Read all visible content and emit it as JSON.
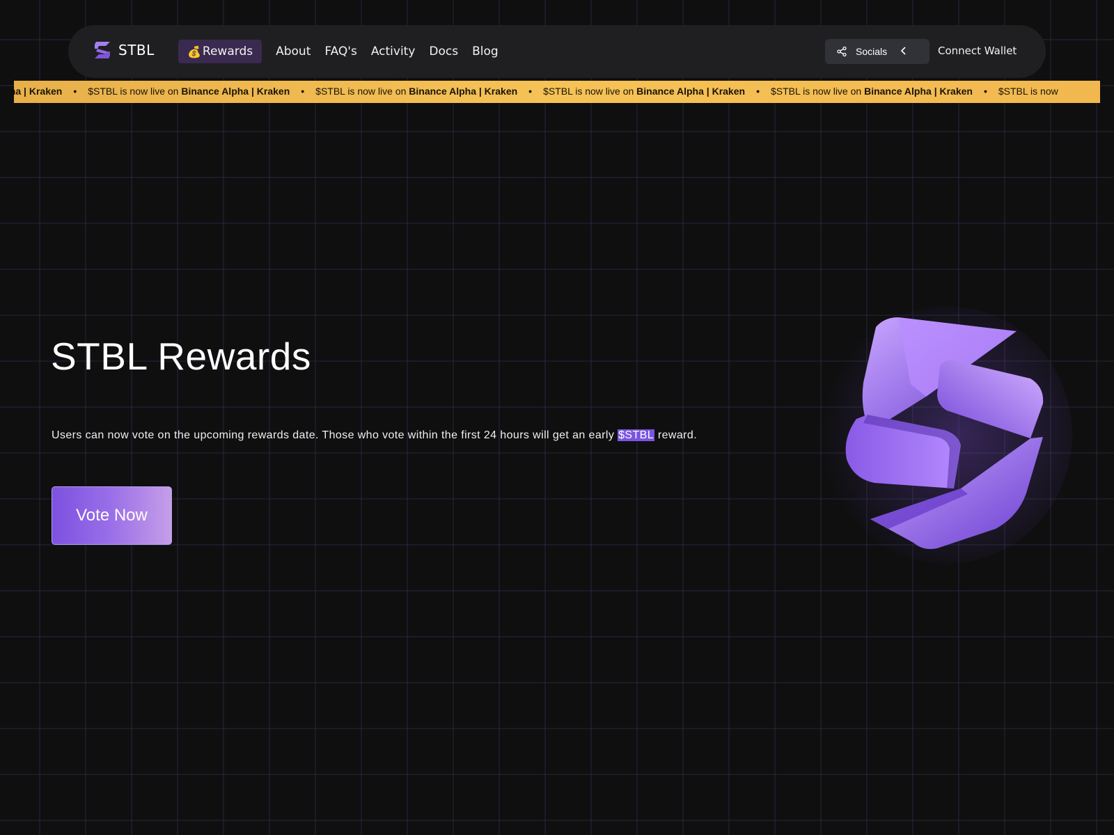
{
  "nav": {
    "logo_text": "STBL",
    "links": [
      {
        "label": "Rewards",
        "active": true
      },
      {
        "label": "About"
      },
      {
        "label": "FAQ's"
      },
      {
        "label": "Activity"
      },
      {
        "label": "Docs"
      },
      {
        "label": "Blog"
      }
    ],
    "socials_label": "Socials",
    "connect_wallet_label": "Connect Wallet"
  },
  "ticker": {
    "first_fragment_bold": "ance Alpha | Kraken",
    "item_prefix": "$STBL is now live on",
    "item_bold": "Binance Alpha | Kraken",
    "last_fragment": "$STBL is now",
    "separator": "•"
  },
  "hero": {
    "title": "STBL Rewards",
    "description_before": "Users can now vote on the upcoming rewards date. Those who vote within the first 24 hours will get an early",
    "description_highlight": "$STBL",
    "description_after": "reward.",
    "cta_label": "Vote Now"
  },
  "colors": {
    "accent": "#7c52e0",
    "ticker_bg": "#f6c256",
    "nav_bg": "#1f1f21",
    "page_bg": "#0f0f10"
  },
  "icons": [
    "stbl-logo-icon",
    "money-bag-icon",
    "share-icon",
    "chevron-left-icon",
    "stbl-emblem"
  ]
}
